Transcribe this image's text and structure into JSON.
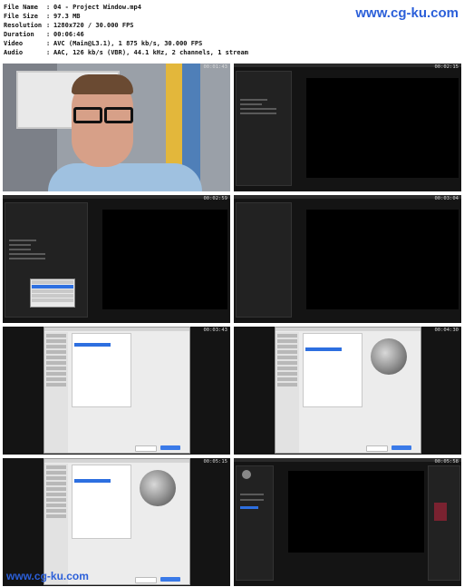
{
  "meta": [
    {
      "key": "File Name",
      "value": "04 - Project Window.mp4"
    },
    {
      "key": "File Size",
      "value": "97.3 MB"
    },
    {
      "key": "Resolution",
      "value": "1280x720 / 30.000 FPS"
    },
    {
      "key": "Duration",
      "value": "00:06:46"
    },
    {
      "key": "Video",
      "value": "AVC (Main@L3.1), 1 875 kb/s, 30.000 FPS"
    },
    {
      "key": "Audio",
      "value": "AAC, 126 kb/s (VBR), 44.1 kHz, 2 channels, 1 stream"
    }
  ],
  "separator": ":",
  "watermark_top": "www.cg-ku.com",
  "watermark_bottom": "www.cg-ku.com",
  "thumbnails": [
    {
      "timestamp": "00:01:43"
    },
    {
      "timestamp": "00:02:15"
    },
    {
      "timestamp": "00:02:59"
    },
    {
      "timestamp": "00:03:04"
    },
    {
      "timestamp": "00:03:43"
    },
    {
      "timestamp": "00:04:30"
    },
    {
      "timestamp": "00:05:15"
    },
    {
      "timestamp": "00:05:58"
    }
  ],
  "colors": {
    "watermark": "#2b5fd9",
    "background": "#ffffff",
    "accent": "#2d6fe0"
  }
}
